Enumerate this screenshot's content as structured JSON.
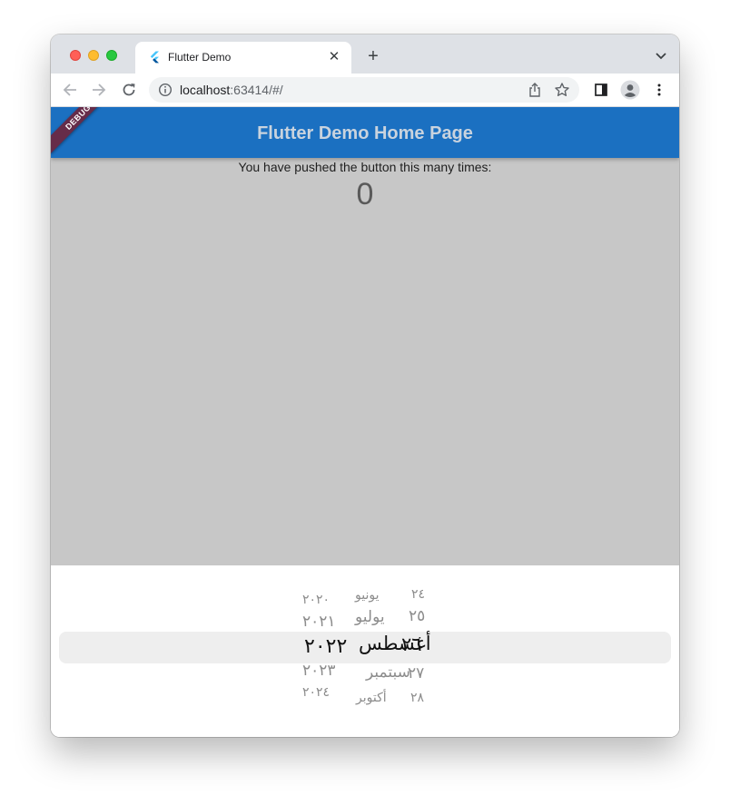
{
  "browser": {
    "tab_title": "Flutter Demo",
    "new_tab_symbol": "+",
    "close_symbol": "✕",
    "url_host": "localhost",
    "url_rest": ":63414/#/"
  },
  "app": {
    "title": "Flutter Demo Home Page",
    "debug_label": "DEBUG",
    "counter_label": "You have pushed the button this many times:",
    "counter_value": "0",
    "appbar_color": "#1b70c1",
    "body_color": "#c7c7c7"
  },
  "date_picker": {
    "years": [
      "٢٠٢٠",
      "٢٠٢١",
      "٢٠٢٢",
      "٢٠٢٣",
      "٢٠٢٤"
    ],
    "months": [
      "يونيو",
      "يوليو",
      "أغسطس",
      "سبتمبر",
      "أكتوبر"
    ],
    "days": [
      "٢٤",
      "٢٥",
      "٢٦",
      "٢٧",
      "٢٨"
    ],
    "selected_index": 2
  }
}
